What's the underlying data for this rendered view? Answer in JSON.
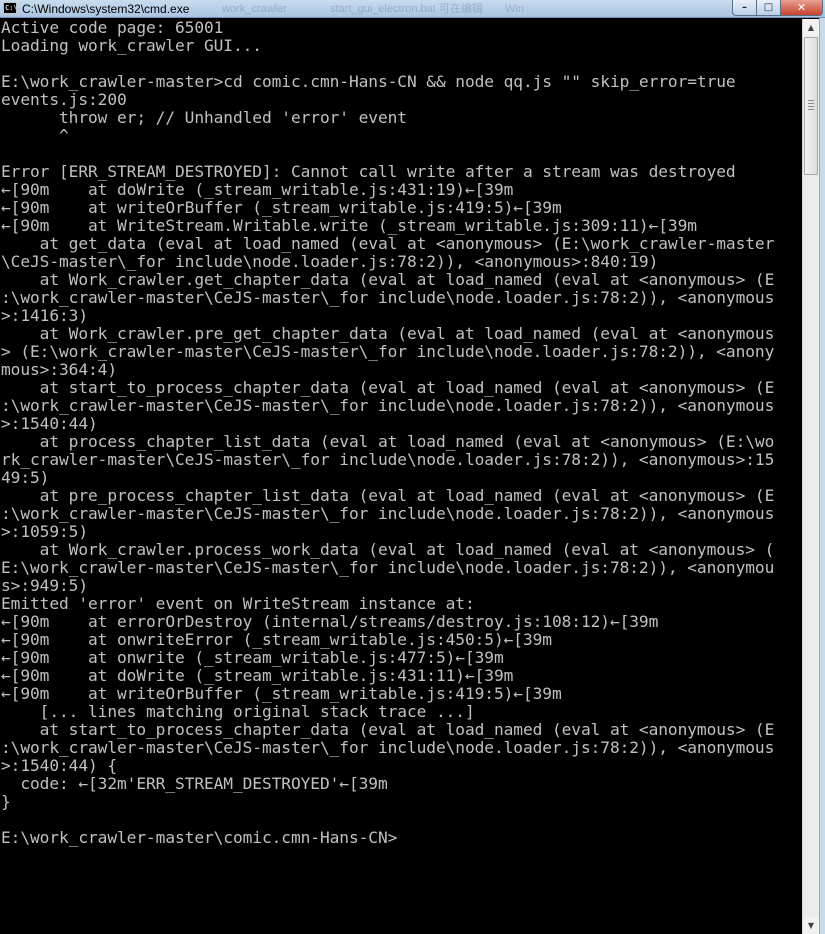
{
  "window": {
    "title": "C:\\Windows\\system32\\cmd.exe",
    "icon_name": "command-prompt-icon",
    "icon_label": "C:\\",
    "minimize_glyph": "–",
    "maximize_glyph": "□",
    "close_glyph": "✕",
    "background_tabs": [
      "work_crawler",
      "start_gui_electron.bat 可在编辑",
      "Win"
    ]
  },
  "console": {
    "text_color": "#c0c0c0",
    "background_color": "#000000",
    "lines": [
      "Active code page: 65001",
      "Loading work_crawler GUI...",
      "",
      "E:\\work_crawler-master>cd comic.cmn-Hans-CN && node qq.js \"\" skip_error=true",
      "events.js:200",
      "      throw er; // Unhandled 'error' event",
      "      ^",
      "",
      "Error [ERR_STREAM_DESTROYED]: Cannot call write after a stream was destroyed",
      "←[90m    at doWrite (_stream_writable.js:431:19)←[39m",
      "←[90m    at writeOrBuffer (_stream_writable.js:419:5)←[39m",
      "←[90m    at WriteStream.Writable.write (_stream_writable.js:309:11)←[39m",
      "    at get_data (eval at load_named (eval at <anonymous> (E:\\work_crawler-master",
      "\\CeJS-master\\_for include\\node.loader.js:78:2)), <anonymous>:840:19)",
      "    at Work_crawler.get_chapter_data (eval at load_named (eval at <anonymous> (E",
      ":\\work_crawler-master\\CeJS-master\\_for include\\node.loader.js:78:2)), <anonymous",
      ">:1416:3)",
      "    at Work_crawler.pre_get_chapter_data (eval at load_named (eval at <anonymous",
      "> (E:\\work_crawler-master\\CeJS-master\\_for include\\node.loader.js:78:2)), <anony",
      "mous>:364:4)",
      "    at start_to_process_chapter_data (eval at load_named (eval at <anonymous> (E",
      ":\\work_crawler-master\\CeJS-master\\_for include\\node.loader.js:78:2)), <anonymous",
      ">:1540:44)",
      "    at process_chapter_list_data (eval at load_named (eval at <anonymous> (E:\\wo",
      "rk_crawler-master\\CeJS-master\\_for include\\node.loader.js:78:2)), <anonymous>:15",
      "49:5)",
      "    at pre_process_chapter_list_data (eval at load_named (eval at <anonymous> (E",
      ":\\work_crawler-master\\CeJS-master\\_for include\\node.loader.js:78:2)), <anonymous",
      ">:1059:5)",
      "    at Work_crawler.process_work_data (eval at load_named (eval at <anonymous> (",
      "E:\\work_crawler-master\\CeJS-master\\_for include\\node.loader.js:78:2)), <anonymou",
      "s>:949:5)",
      "Emitted 'error' event on WriteStream instance at:",
      "←[90m    at errorOrDestroy (internal/streams/destroy.js:108:12)←[39m",
      "←[90m    at onwriteError (_stream_writable.js:450:5)←[39m",
      "←[90m    at onwrite (_stream_writable.js:477:5)←[39m",
      "←[90m    at doWrite (_stream_writable.js:431:11)←[39m",
      "←[90m    at writeOrBuffer (_stream_writable.js:419:5)←[39m",
      "    [... lines matching original stack trace ...]",
      "    at start_to_process_chapter_data (eval at load_named (eval at <anonymous> (E",
      ":\\work_crawler-master\\CeJS-master\\_for include\\node.loader.js:78:2)), <anonymous",
      ">:1540:44) {",
      "  code: ←[32m'ERR_STREAM_DESTROYED'←[39m",
      "}",
      "",
      "E:\\work_crawler-master\\comic.cmn-Hans-CN>"
    ]
  },
  "scrollbar": {
    "up_glyph": "▲",
    "down_glyph": "▼"
  }
}
